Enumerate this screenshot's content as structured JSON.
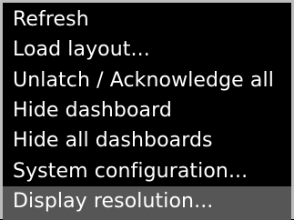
{
  "context_menu": {
    "items": [
      {
        "label": "Refresh",
        "highlighted": false
      },
      {
        "label": "Load layout...",
        "highlighted": false
      },
      {
        "label": "Unlatch / Acknowledge all",
        "highlighted": false
      },
      {
        "label": "Hide dashboard",
        "highlighted": false
      },
      {
        "label": "Hide all dashboards",
        "highlighted": false
      },
      {
        "label": "System configuration...",
        "highlighted": false
      },
      {
        "label": "Display resolution...",
        "highlighted": true
      }
    ],
    "colors": {
      "background": "#000000",
      "text": "#ffffff",
      "highlight": "#565656",
      "border": "#bdbdbd"
    }
  }
}
